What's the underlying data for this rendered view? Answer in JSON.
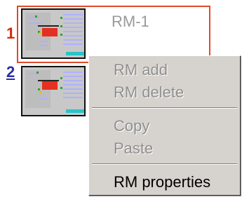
{
  "slots": [
    {
      "number": "1",
      "title": "RM-1"
    },
    {
      "number": "2"
    }
  ],
  "context_menu": {
    "items": [
      {
        "label": "RM add",
        "enabled": false
      },
      {
        "label": "RM delete",
        "enabled": false
      },
      {
        "label": "Copy",
        "enabled": false
      },
      {
        "label": "Paste",
        "enabled": false
      },
      {
        "label": "RM properties",
        "enabled": true
      }
    ]
  },
  "colors": {
    "slot1_number": "#d42a0e",
    "slot2_number": "#2b2fa6",
    "selection_border": "#e04a2a",
    "menu_background": "#d6d3ce",
    "disabled_text": "#8f8f8f"
  }
}
